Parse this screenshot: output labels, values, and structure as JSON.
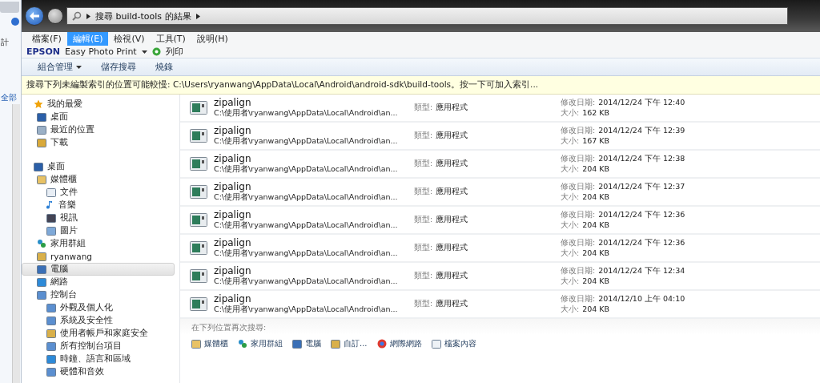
{
  "background_window": {
    "texts": [
      "計",
      "全部"
    ]
  },
  "address_bar": {
    "crumbs": [
      "搜尋 build-tools 的結果"
    ]
  },
  "menu_bar": [
    {
      "label": "檔案(F)",
      "selected": false
    },
    {
      "label": "編輯(E)",
      "selected": true
    },
    {
      "label": "檢視(V)",
      "selected": false
    },
    {
      "label": "工具(T)",
      "selected": false
    },
    {
      "label": "說明(H)",
      "selected": false
    }
  ],
  "epson_bar": {
    "brand": "EPSON",
    "app": "Easy Photo Print",
    "print": "列印"
  },
  "toolbar": [
    {
      "label": "組合管理",
      "dropdown": true
    },
    {
      "label": "儲存搜尋",
      "dropdown": false
    },
    {
      "label": "燒錄",
      "dropdown": false
    }
  ],
  "info_bar": "搜尋下列未編製索引的位置可能較慢: C:\\Users\\ryanwang\\AppData\\Local\\Android\\android-sdk\\build-tools。按一下可加入索引...",
  "nav_pane": [
    {
      "label": "我的最愛",
      "selected": false,
      "children": [
        {
          "label": "桌面",
          "selected": false
        },
        {
          "label": "最近的位置",
          "selected": false
        },
        {
          "label": "下載",
          "selected": false
        }
      ]
    },
    {
      "label": "桌面",
      "selected": false,
      "children": [
        {
          "label": "媒體櫃",
          "selected": false,
          "children": [
            {
              "label": "文件",
              "selected": false
            },
            {
              "label": "音樂",
              "selected": false
            },
            {
              "label": "視訊",
              "selected": false
            },
            {
              "label": "圖片",
              "selected": false
            }
          ]
        },
        {
          "label": "家用群組",
          "selected": false
        },
        {
          "label": "ryanwang",
          "selected": false
        },
        {
          "label": "電腦",
          "selected": true
        },
        {
          "label": "網路",
          "selected": false
        },
        {
          "label": "控制台",
          "selected": false,
          "children": [
            {
              "label": "外觀及個人化",
              "selected": false
            },
            {
              "label": "系統及安全性",
              "selected": false
            },
            {
              "label": "使用者帳戶和家庭安全",
              "selected": false
            },
            {
              "label": "所有控制台項目",
              "selected": false
            },
            {
              "label": "時鐘、語言和區域",
              "selected": false
            },
            {
              "label": "硬體和音效",
              "selected": false
            }
          ]
        }
      ]
    }
  ],
  "results": [
    {
      "name": "zipalign",
      "path": "C:\\使用者\\ryanwang\\AppData\\Local\\Android\\an...",
      "type_label": "類型:",
      "type": "應用程式",
      "date_label": "修改日期:",
      "date": "2014/12/24 下午 12:40",
      "size_label": "大小:",
      "size": "162 KB"
    },
    {
      "name": "zipalign",
      "path": "C:\\使用者\\ryanwang\\AppData\\Local\\Android\\an...",
      "type_label": "類型:",
      "type": "應用程式",
      "date_label": "修改日期:",
      "date": "2014/12/24 下午 12:39",
      "size_label": "大小:",
      "size": "167 KB"
    },
    {
      "name": "zipalign",
      "path": "C:\\使用者\\ryanwang\\AppData\\Local\\Android\\an...",
      "type_label": "類型:",
      "type": "應用程式",
      "date_label": "修改日期:",
      "date": "2014/12/24 下午 12:38",
      "size_label": "大小:",
      "size": "204 KB"
    },
    {
      "name": "zipalign",
      "path": "C:\\使用者\\ryanwang\\AppData\\Local\\Android\\an...",
      "type_label": "類型:",
      "type": "應用程式",
      "date_label": "修改日期:",
      "date": "2014/12/24 下午 12:37",
      "size_label": "大小:",
      "size": "204 KB"
    },
    {
      "name": "zipalign",
      "path": "C:\\使用者\\ryanwang\\AppData\\Local\\Android\\an...",
      "type_label": "類型:",
      "type": "應用程式",
      "date_label": "修改日期:",
      "date": "2014/12/24 下午 12:36",
      "size_label": "大小:",
      "size": "204 KB"
    },
    {
      "name": "zipalign",
      "path": "C:\\使用者\\ryanwang\\AppData\\Local\\Android\\an...",
      "type_label": "類型:",
      "type": "應用程式",
      "date_label": "修改日期:",
      "date": "2014/12/24 下午 12:36",
      "size_label": "大小:",
      "size": "204 KB"
    },
    {
      "name": "zipalign",
      "path": "C:\\使用者\\ryanwang\\AppData\\Local\\Android\\an...",
      "type_label": "類型:",
      "type": "應用程式",
      "date_label": "修改日期:",
      "date": "2014/12/24 下午 12:34",
      "size_label": "大小:",
      "size": "204 KB"
    },
    {
      "name": "zipalign",
      "path": "C:\\使用者\\ryanwang\\AppData\\Local\\Android\\an...",
      "type_label": "類型:",
      "type": "應用程式",
      "date_label": "修改日期:",
      "date": "2014/12/10 上午 04:10",
      "size_label": "大小:",
      "size": "204 KB"
    }
  ],
  "search_again": {
    "title": "在下列位置再次搜尋:",
    "locations": [
      "媒體櫃",
      "家用群組",
      "電腦",
      "自訂...",
      "網際網路",
      "檔案內容"
    ]
  }
}
